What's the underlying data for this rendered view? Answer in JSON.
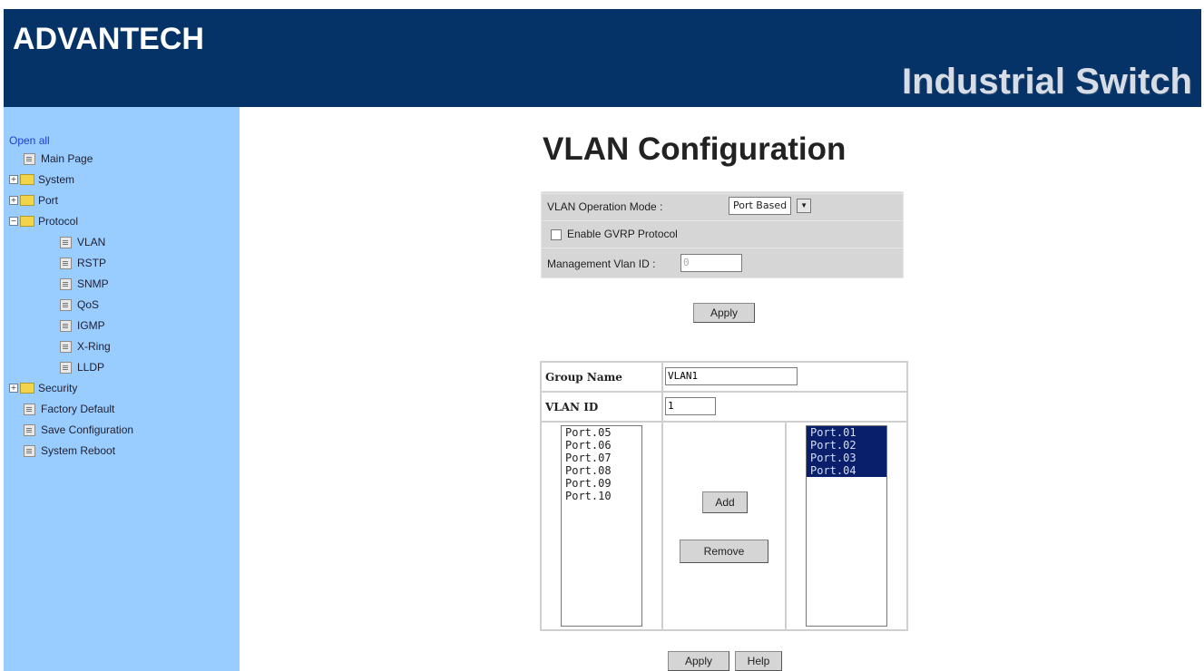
{
  "header": {
    "brand": "ADVANTECH",
    "product": "Industrial Switch"
  },
  "sidebar": {
    "open_all": "Open all",
    "items": [
      {
        "label": "Main Page",
        "type": "doc",
        "expander": ""
      },
      {
        "label": "System",
        "type": "folder",
        "expander": "+"
      },
      {
        "label": "Port",
        "type": "folder",
        "expander": "+"
      },
      {
        "label": "Protocol",
        "type": "folder-open",
        "expander": "−"
      },
      {
        "label": "VLAN",
        "type": "doc-sub",
        "expander": ""
      },
      {
        "label": "RSTP",
        "type": "doc-sub",
        "expander": ""
      },
      {
        "label": "SNMP",
        "type": "doc-sub",
        "expander": ""
      },
      {
        "label": "QoS",
        "type": "doc-sub",
        "expander": ""
      },
      {
        "label": "IGMP",
        "type": "doc-sub",
        "expander": ""
      },
      {
        "label": "X-Ring",
        "type": "doc-sub",
        "expander": ""
      },
      {
        "label": "LLDP",
        "type": "doc-sub",
        "expander": ""
      },
      {
        "label": "Security",
        "type": "folder",
        "expander": "+"
      },
      {
        "label": "Factory Default",
        "type": "doc",
        "expander": ""
      },
      {
        "label": "Save Configuration",
        "type": "doc",
        "expander": ""
      },
      {
        "label": "System Reboot",
        "type": "doc",
        "expander": ""
      }
    ]
  },
  "main": {
    "title": "VLAN Configuration",
    "mode_label": "VLAN Operation Mode :",
    "mode_value": "Port Based",
    "gvrp_label": "Enable GVRP Protocol",
    "mgmt_label": "Management Vlan ID :",
    "mgmt_value": "0",
    "apply_label": "Apply",
    "group_name_label": "Group Name",
    "group_name_value": "VLAN1",
    "vlan_id_label": "VLAN ID",
    "vlan_id_value": "1",
    "available_ports": [
      "Port.05",
      "Port.06",
      "Port.07",
      "Port.08",
      "Port.09",
      "Port.10"
    ],
    "member_ports": [
      "Port.01",
      "Port.02",
      "Port.03",
      "Port.04"
    ],
    "add_label": "Add",
    "remove_label": "Remove",
    "apply2_label": "Apply",
    "help_label": "Help"
  }
}
